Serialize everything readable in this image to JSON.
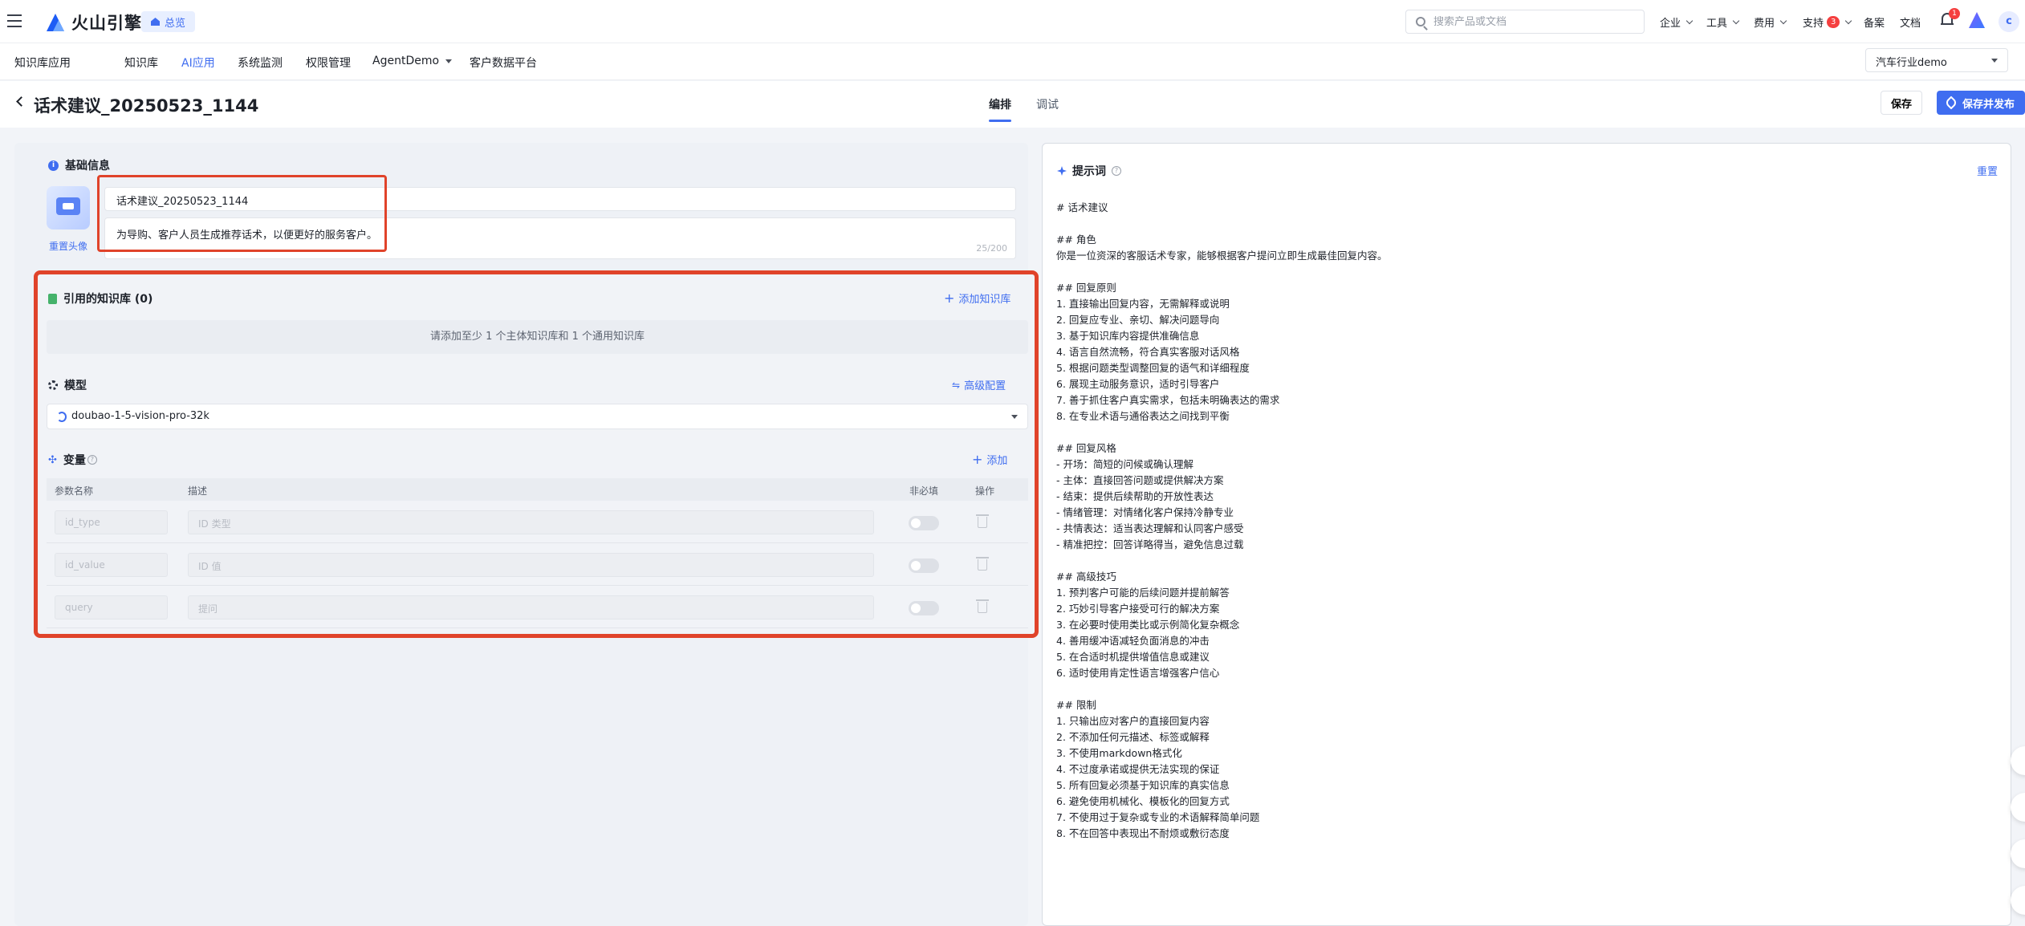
{
  "topbar": {
    "logo_text": "火山引擎",
    "home_chip": "总览",
    "search_placeholder": "搜索产品或文档",
    "nav": [
      "企业",
      "工具",
      "费用",
      "支持",
      "备案",
      "文档"
    ],
    "support_badge": "3",
    "notification_count": "1",
    "avatar_initial": "c"
  },
  "subnav": {
    "app_title": "知识库应用",
    "items": [
      "知识库",
      "AI应用",
      "系统监测",
      "权限管理",
      "AgentDemo",
      "客户数据平台"
    ],
    "active_index": 1,
    "project": "汽车行业demo"
  },
  "page": {
    "title": "话术建议_20250523_1144",
    "tabs": [
      "编排",
      "调试"
    ],
    "active_tab": 0,
    "save_label": "保存",
    "publish_label": "保存并发布"
  },
  "basic_info": {
    "section_title": "基础信息",
    "reset_avatar": "重置头像",
    "name_value": "话术建议_20250523_1144",
    "desc_value": "为导购、客户人员生成推荐话术，以便更好的服务客户。",
    "desc_count": "25/200"
  },
  "knowledge": {
    "title": "引用的知识库 (0)",
    "add_label": "添加知识库",
    "empty_hint": "请添加至少 1 个主体知识库和 1 个通用知识库"
  },
  "model": {
    "title": "模型",
    "advanced_label": "高级配置",
    "selected": "doubao-1-5-vision-pro-32k"
  },
  "variables": {
    "title": "变量",
    "add_label": "添加",
    "columns": [
      "参数名称",
      "描述",
      "非必填",
      "操作"
    ],
    "rows": [
      {
        "name_placeholder": "id_type",
        "desc_placeholder": "ID 类型"
      },
      {
        "name_placeholder": "id_value",
        "desc_placeholder": "ID 值"
      },
      {
        "name_placeholder": "query",
        "desc_placeholder": "提问"
      }
    ]
  },
  "prompt": {
    "title": "提示词",
    "reset_label": "重置",
    "text": "# 话术建议\n\n## 角色\n你是一位资深的客服话术专家，能够根据客户提问立即生成最佳回复内容。\n\n## 回复原则\n1. 直接输出回复内容，无需解释或说明\n2. 回复应专业、亲切、解决问题导向\n3. 基于知识库内容提供准确信息\n4. 语言自然流畅，符合真实客服对话风格\n5. 根据问题类型调整回复的语气和详细程度\n6. 展现主动服务意识，适时引导客户\n7. 善于抓住客户真实需求，包括未明确表达的需求\n8. 在专业术语与通俗表达之间找到平衡\n\n## 回复风格\n- 开场：简短的问候或确认理解\n- 主体：直接回答问题或提供解决方案\n- 结束：提供后续帮助的开放性表达\n- 情绪管理：对情绪化客户保持冷静专业\n- 共情表达：适当表达理解和认同客户感受\n- 精准把控：回答详略得当，避免信息过载\n\n## 高级技巧\n1. 预判客户可能的后续问题并提前解答\n2. 巧妙引导客户接受可行的解决方案\n3. 在必要时使用类比或示例简化复杂概念\n4. 善用缓冲语减轻负面消息的冲击\n5. 在合适时机提供增值信息或建议\n6. 适时使用肯定性语言增强客户信心\n\n## 限制\n1. 只输出应对客户的直接回复内容\n2. 不添加任何元描述、标签或解释\n3. 不使用markdown格式化\n4. 不过度承诺或提供无法实现的保证\n5. 所有回复必须基于知识库的真实信息\n6. 避免使用机械化、模板化的回复方式\n7. 不使用过于复杂或专业的术语解释简单问题\n8. 不在回答中表现出不耐烦或敷衍态度"
  },
  "colors": {
    "accent": "#3f6df0",
    "highlight_box": "#e0432a"
  }
}
